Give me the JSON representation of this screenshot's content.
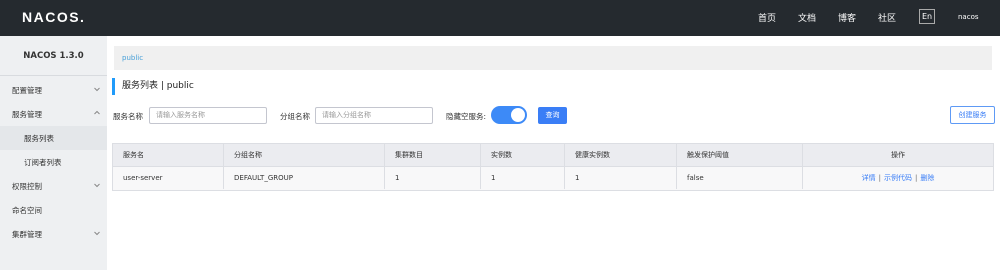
{
  "topbar": {
    "logo_text": "NACOS.",
    "nav": [
      "首页",
      "文档",
      "博客",
      "社区"
    ],
    "lang": "En",
    "user": "nacos"
  },
  "sidebar": {
    "title": "NACOS 1.3.0",
    "items": [
      {
        "label": "配置管理",
        "icon": "chevron-down-icon"
      },
      {
        "label": "服务管理",
        "icon": "chevron-up-icon"
      },
      {
        "label": "服务列表"
      },
      {
        "label": "订阅者列表"
      },
      {
        "label": "权限控制",
        "icon": "chevron-down-icon"
      },
      {
        "label": "命名空间"
      },
      {
        "label": "集群管理",
        "icon": "chevron-down-icon"
      }
    ]
  },
  "namespace": "public",
  "page_heading": "服务列表 | public",
  "filters": {
    "service_name_label": "服务名称",
    "service_name_placeholder": "请输入服务名称",
    "group_name_label": "分组名称",
    "group_name_placeholder": "请输入分组名称",
    "hide_empty_label": "隐藏空服务:",
    "hide_empty_on": true,
    "query_label": "查询",
    "create_label": "创建服务"
  },
  "table": {
    "headers": [
      "服务名",
      "分组名称",
      "集群数目",
      "实例数",
      "健康实例数",
      "触发保护阈值",
      "操作"
    ],
    "rows": [
      {
        "cells": [
          "user-server",
          "DEFAULT_GROUP",
          "1",
          "1",
          "1",
          "false"
        ],
        "ops": [
          "详情",
          "示例代码",
          "删除"
        ]
      }
    ]
  },
  "colors": {
    "topbar": "#252a2f",
    "accent": "#3a7ef6",
    "sidebar": "#eef0f2"
  }
}
